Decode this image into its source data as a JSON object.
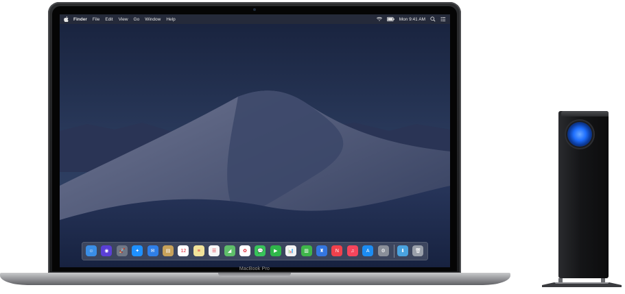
{
  "menubar": {
    "app_name": "Finder",
    "items": [
      "File",
      "Edit",
      "View",
      "Go",
      "Window",
      "Help"
    ],
    "clock": "Mon 9:41 AM"
  },
  "laptop": {
    "label": "MacBook Pro"
  },
  "dock": {
    "icons": [
      {
        "name": "finder-icon",
        "color": "#3a8ee6",
        "glyph": "☺"
      },
      {
        "name": "siri-icon",
        "color": "#5a3fd6",
        "glyph": "◉"
      },
      {
        "name": "launchpad-icon",
        "color": "#6f7786",
        "glyph": "🚀"
      },
      {
        "name": "safari-icon",
        "color": "#1e90ff",
        "glyph": "✦"
      },
      {
        "name": "mail-icon",
        "color": "#2f7fe8",
        "glyph": "✉"
      },
      {
        "name": "contacts-icon",
        "color": "#c8a25a",
        "glyph": "▤"
      },
      {
        "name": "calendar-icon",
        "color": "#ffffff",
        "glyph": "12"
      },
      {
        "name": "notes-icon",
        "color": "#f2e39a",
        "glyph": "≡"
      },
      {
        "name": "reminders-icon",
        "color": "#f5f5f5",
        "glyph": "☰"
      },
      {
        "name": "maps-icon",
        "color": "#5fbf6a",
        "glyph": "◢"
      },
      {
        "name": "photos-icon",
        "color": "#ffffff",
        "glyph": "✿"
      },
      {
        "name": "messages-icon",
        "color": "#38c45a",
        "glyph": "💬"
      },
      {
        "name": "facetime-icon",
        "color": "#2fb64a",
        "glyph": "▶"
      },
      {
        "name": "keynote-icon",
        "color": "#f2f2f2",
        "glyph": "📊"
      },
      {
        "name": "numbers-icon",
        "color": "#3fb54a",
        "glyph": "▥"
      },
      {
        "name": "keynote-podium-icon",
        "color": "#3476e0",
        "glyph": "♜"
      },
      {
        "name": "news-icon",
        "color": "#f0414c",
        "glyph": "N"
      },
      {
        "name": "music-icon",
        "color": "#f5455c",
        "glyph": "♫"
      },
      {
        "name": "app-store-icon",
        "color": "#1c8cf2",
        "glyph": "A"
      },
      {
        "name": "system-preferences-icon",
        "color": "#8a8f99",
        "glyph": "⚙"
      },
      {
        "name": "downloads-folder-icon",
        "color": "#4aa3df",
        "glyph": "⬇"
      },
      {
        "name": "trash-icon",
        "color": "#9aa0aa",
        "glyph": "🗑"
      }
    ]
  },
  "colors": {
    "accent_blue": "#1e6fff",
    "menubar_text": "#e8e8e8"
  }
}
